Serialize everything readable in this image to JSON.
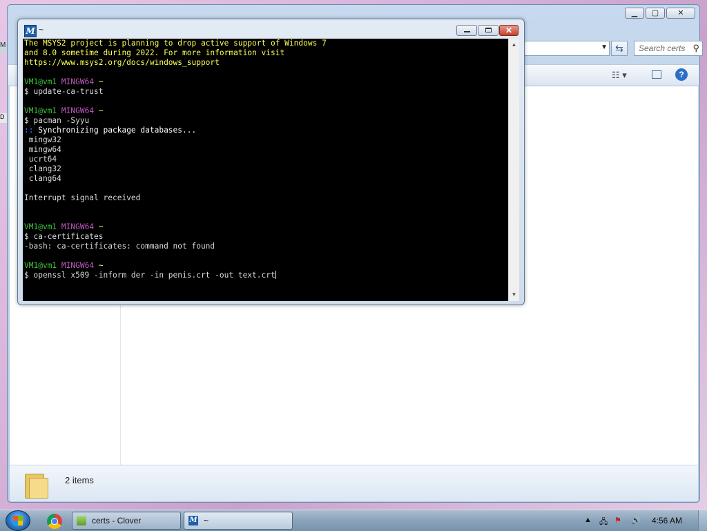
{
  "explorer": {
    "search_placeholder": "Search certs",
    "status": "2 items",
    "controls": {
      "minimize": "▁",
      "maximize": "▢",
      "close": "✕"
    }
  },
  "terminal": {
    "title": "~",
    "lines": [
      {
        "text": "The MSYS2 project is planning to drop active support of Windows 7",
        "style": "yellow"
      },
      {
        "text": "and 8.0 sometime during 2022. For more information visit",
        "style": "yellow"
      },
      {
        "text": "https://www.msys2.org/docs/windows_support",
        "style": "yellow"
      },
      {
        "text": "",
        "style": "normal"
      },
      {
        "prompt": true,
        "user": "VM1@vm1",
        "env": "MINGW64",
        "dir": "~"
      },
      {
        "text": "$ update-ca-trust",
        "style": "normal"
      },
      {
        "text": "",
        "style": "normal"
      },
      {
        "prompt": true,
        "user": "VM1@vm1",
        "env": "MINGW64",
        "dir": "~"
      },
      {
        "text": "$ pacman -Syyu",
        "style": "normal"
      },
      {
        "text": ":: Synchronizing package databases...",
        "style": "sync"
      },
      {
        "text": " mingw32",
        "style": "normal"
      },
      {
        "text": " mingw64",
        "style": "normal"
      },
      {
        "text": " ucrt64",
        "style": "normal"
      },
      {
        "text": " clang32",
        "style": "normal"
      },
      {
        "text": " clang64",
        "style": "normal"
      },
      {
        "text": "",
        "style": "normal"
      },
      {
        "text": "Interrupt signal received",
        "style": "normal"
      },
      {
        "text": "",
        "style": "normal"
      },
      {
        "text": "",
        "style": "normal"
      },
      {
        "prompt": true,
        "user": "VM1@vm1",
        "env": "MINGW64",
        "dir": "~"
      },
      {
        "text": "$ ca-certificates",
        "style": "normal"
      },
      {
        "text": "-bash: ca-certificates: command not found",
        "style": "normal"
      },
      {
        "text": "",
        "style": "normal"
      },
      {
        "prompt": true,
        "user": "VM1@vm1",
        "env": "MINGW64",
        "dir": "~"
      },
      {
        "text": "$ openssl x509 -inform der -in penis.crt -out text.crt",
        "style": "normal",
        "cursor": true
      }
    ]
  },
  "taskbar": {
    "tasks": [
      {
        "label": "certs - Clover"
      },
      {
        "label": "~"
      }
    ],
    "clock": "4:56 AM"
  },
  "colors": {
    "terminal_bg": "#000000",
    "yellow": "#ffff55",
    "green": "#3ec43e",
    "purple": "#c05ac0"
  }
}
